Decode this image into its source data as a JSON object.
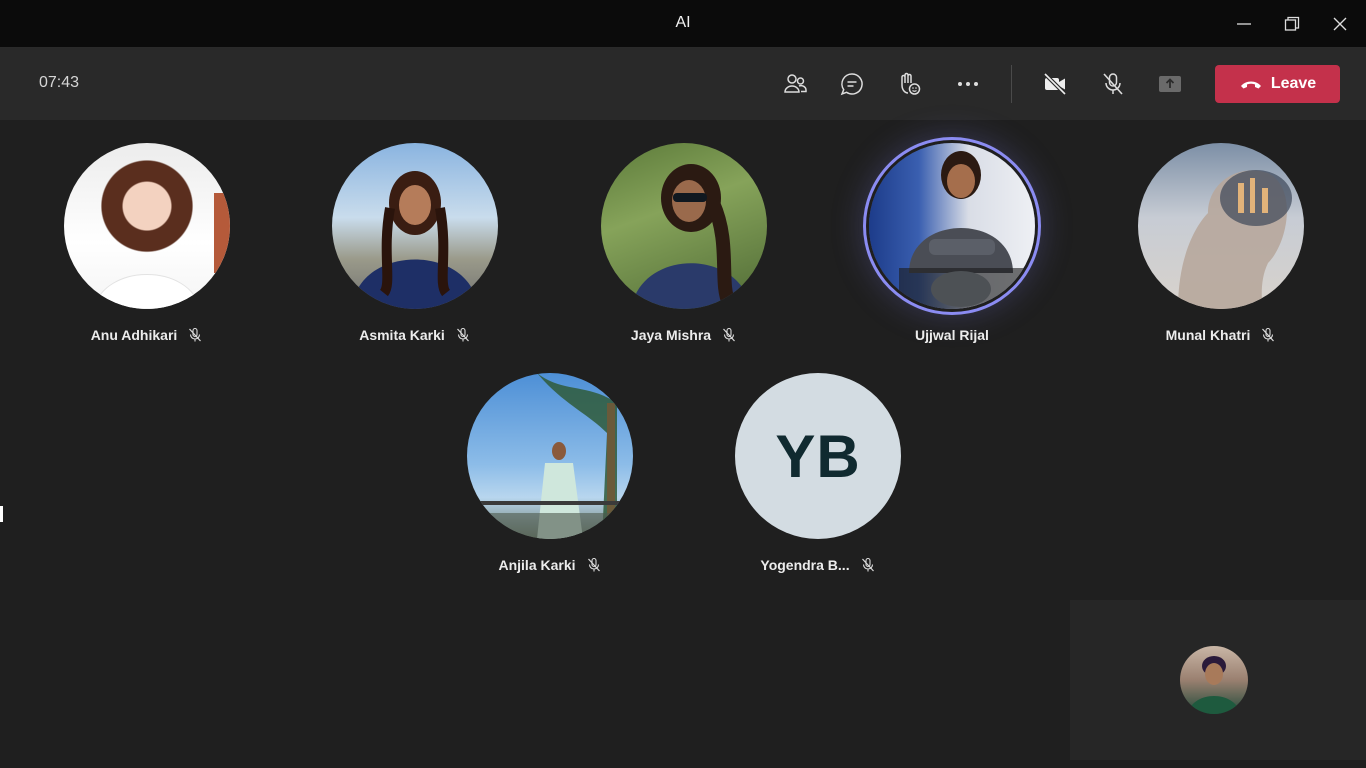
{
  "window": {
    "title": "AI",
    "controls": [
      "minimize-icon",
      "restore-icon",
      "close-icon"
    ]
  },
  "toolbar": {
    "timer": "07:43",
    "buttons": [
      "participants-icon",
      "chat-icon",
      "reactions-icon",
      "more-options-icon",
      "camera-off-icon",
      "mic-off-icon",
      "share-screen-icon"
    ],
    "leave_label": "Leave",
    "leave_color": "#c4314b"
  },
  "participants": [
    {
      "name": "Anu Adhikari",
      "muted": true,
      "avatar": "photo"
    },
    {
      "name": "Asmita Karki",
      "muted": true,
      "avatar": "photo"
    },
    {
      "name": "Jaya Mishra",
      "muted": true,
      "avatar": "photo"
    },
    {
      "name": "Ujjwal Rijal",
      "muted": false,
      "speaking": true,
      "avatar": "photo"
    },
    {
      "name": "Munal Khatri",
      "muted": true,
      "avatar": "photo"
    },
    {
      "name": "Anjila Karki",
      "muted": true,
      "avatar": "photo"
    },
    {
      "name": "Yogendra B...",
      "muted": true,
      "avatar": "initials",
      "initials": "YB"
    }
  ],
  "accent": {
    "speaking_ring": "#8b8cf2"
  }
}
